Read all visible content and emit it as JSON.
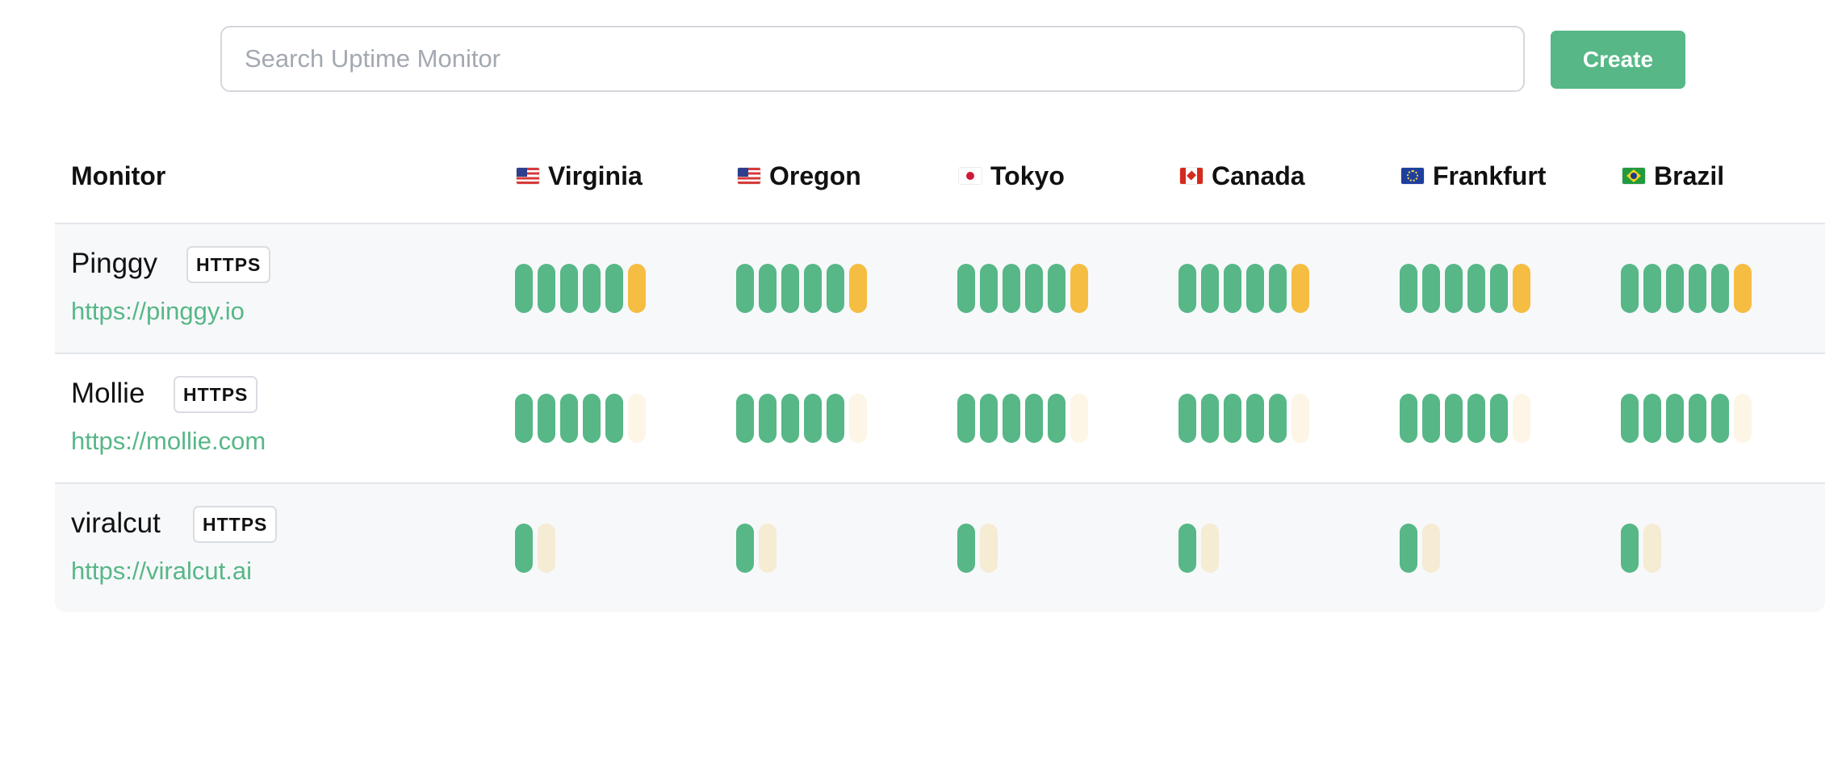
{
  "search": {
    "placeholder": "Search Uptime Monitor",
    "value": ""
  },
  "toolbar": {
    "create_label": "Create"
  },
  "colors": {
    "up": "#57b787",
    "degraded": "#f5bd41",
    "unknown": "#fdf5e6",
    "pending": "#f6ebd3",
    "accent": "#57b787"
  },
  "table": {
    "monitor_header": "Monitor",
    "regions": [
      {
        "label": "Virginia",
        "flag": "us-flag"
      },
      {
        "label": "Oregon",
        "flag": "us-flag"
      },
      {
        "label": "Tokyo",
        "flag": "jp-flag"
      },
      {
        "label": "Canada",
        "flag": "ca-flag"
      },
      {
        "label": "Frankfurt",
        "flag": "eu-flag"
      },
      {
        "label": "Brazil",
        "flag": "br-flag"
      }
    ],
    "rows": [
      {
        "name": "Pinggy",
        "protocol": "HTTPS",
        "url": "https://pinggy.io",
        "statuses": [
          "up",
          "up",
          "up",
          "up",
          "up",
          "degraded"
        ]
      },
      {
        "name": "Mollie",
        "protocol": "HTTPS",
        "url": "https://mollie.com",
        "statuses": [
          "up",
          "up",
          "up",
          "up",
          "up",
          "unknown"
        ]
      },
      {
        "name": "viralcut",
        "protocol": "HTTPS",
        "url": "https://viralcut.ai",
        "statuses": [
          "up",
          "pending"
        ]
      }
    ]
  }
}
